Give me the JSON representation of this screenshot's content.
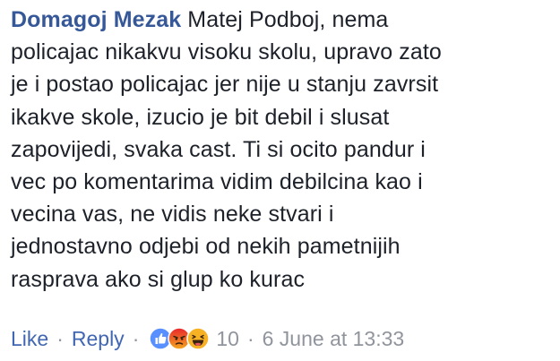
{
  "comment": {
    "author": "Domagoj Mezak",
    "text": "Matej Podboj, nema\npolicajac nikakvu visoku skolu, upravo zato\nje i postao policajac jer nije u stanju zavrsit\nikakve skole, izucio je bit debil i slusat\nzapovijedi, svaka cast. Ti si ocito pandur i\nvec po komentarima vidim debilcina kao i\nvecina vas, ne vidis neke stvari i\njednostavno odjebi od nekih pametnijih\nrasprava ako si glup ko kurac"
  },
  "actions": {
    "like_label": "Like",
    "separator": "·",
    "reply_label": "Reply",
    "reactions": [
      {
        "icon": "like-icon",
        "color": "#5890ff"
      },
      {
        "icon": "angry-icon",
        "color": "#e9710f"
      },
      {
        "icon": "haha-icon",
        "color": "#f7b125"
      }
    ],
    "reaction_count": "10",
    "timestamp": "6 June at 13:33"
  }
}
